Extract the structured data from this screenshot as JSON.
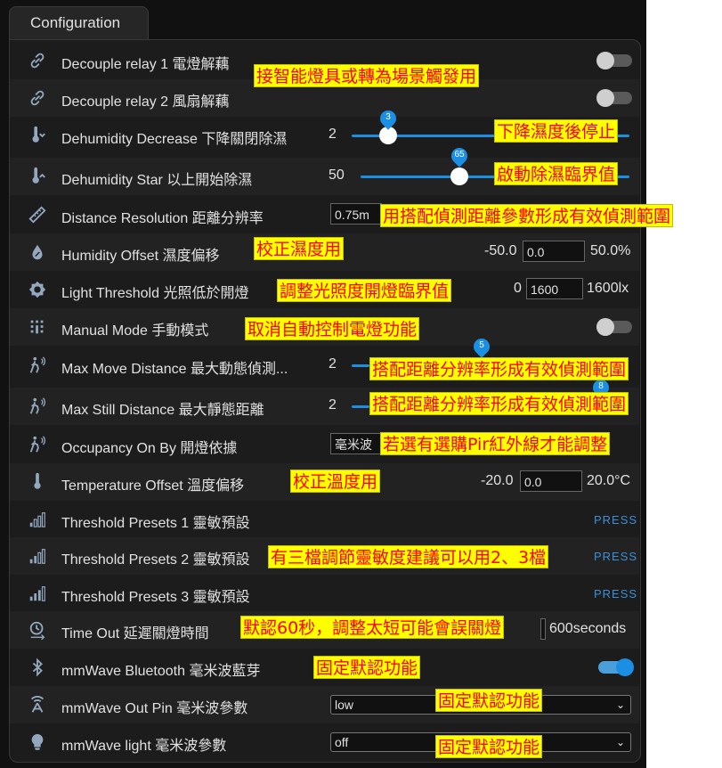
{
  "tab": {
    "label": "Configuration"
  },
  "colors": {
    "accent": "#1a8fe3",
    "annotation_bg": "#ffff00",
    "annotation_text": "#ff0000",
    "panel_bg": "#1c1c1c"
  },
  "rows": [
    {
      "label": "Decouple relay 1 電燈解藕",
      "icon": "link-icon",
      "toggle": "off"
    },
    {
      "label": "Decouple relay 2 風扇解藕",
      "icon": "link-icon",
      "toggle": "off"
    },
    {
      "label": "Dehumidity Decrease 下降關閉除濕",
      "icon": "thermometer-down-icon",
      "value": "2",
      "slider_value": "3",
      "slider_fraction": 0.0
    },
    {
      "label": "Dehumidity Star 以上開始除濕",
      "icon": "thermometer-up-icon",
      "value": "50",
      "slider_value": "65",
      "slider_fraction": 0.49
    },
    {
      "label": "Distance Resolution 距離分辨率",
      "icon": "ruler-icon",
      "select_value": "0.75m"
    },
    {
      "label": "Humidity Offset 濕度偏移",
      "icon": "water-percent-icon",
      "min": "-50.0",
      "input": "0.0",
      "max": "50.0%"
    },
    {
      "label": "Light Threshold 光照低於開燈",
      "icon": "brightness-icon",
      "min": "0",
      "input": "1600",
      "max": "1600lx"
    },
    {
      "label": "Manual Mode 手動模式",
      "icon": "dots-grid-icon",
      "toggle": "off"
    },
    {
      "label": "Max Move Distance 最大動態偵測...",
      "icon": "motion-sensor-icon",
      "value": "2",
      "slider_value": "5"
    },
    {
      "label": "Max Still Distance 最大靜態距離",
      "icon": "motion-sensor-icon",
      "value": "2",
      "slider_value": "8"
    },
    {
      "label": "Occupancy On By 開燈依據",
      "icon": "motion-sensor-icon",
      "select_value": "毫米波"
    },
    {
      "label": "Temperature Offset 溫度偏移",
      "icon": "thermometer-icon",
      "min": "-20.0",
      "input": "0.0",
      "max": "20.0°C"
    },
    {
      "label": "Threshold Presets 1 靈敏預設",
      "icon": "signal-bars-1-icon",
      "action": "PRESS"
    },
    {
      "label": "Threshold Presets 2 靈敏預設",
      "icon": "signal-bars-2-icon",
      "action": "PRESS"
    },
    {
      "label": "Threshold Presets 3 靈敏預設",
      "icon": "signal-bars-3-icon",
      "action": "PRESS"
    },
    {
      "label": "Time Out 延遲關燈時間",
      "icon": "timer-icon",
      "max": "600seconds"
    },
    {
      "label": "mmWave Bluetooth 毫米波藍芽",
      "icon": "bluetooth-icon",
      "toggle": "on"
    },
    {
      "label": "mmWave Out Pin 毫米波參數",
      "icon": "radar-icon",
      "select_value": "low"
    },
    {
      "label": "mmWave light 毫米波參數",
      "icon": "lightbulb-icon",
      "select_value": "off"
    }
  ],
  "annotations": [
    "接智能燈具或轉為場景觸發用",
    "下降濕度後停止",
    "啟動除濕臨界值",
    "用搭配偵測距離參數形成有效偵測範圍",
    "校正濕度用",
    "調整光照度開燈臨界值",
    "取消自動控制電燈功能",
    "搭配距離分辨率形成有效偵測範圍",
    "搭配距離分辨率形成有效偵測範圍",
    "若選有選購Pir紅外線才能調整",
    "校正溫度用",
    "有三檔調節靈敏度建議可以用2、3檔",
    "默認60秒，調整太短可能會誤關燈",
    "固定默認功能",
    "固定默認功能",
    "固定默認功能"
  ]
}
